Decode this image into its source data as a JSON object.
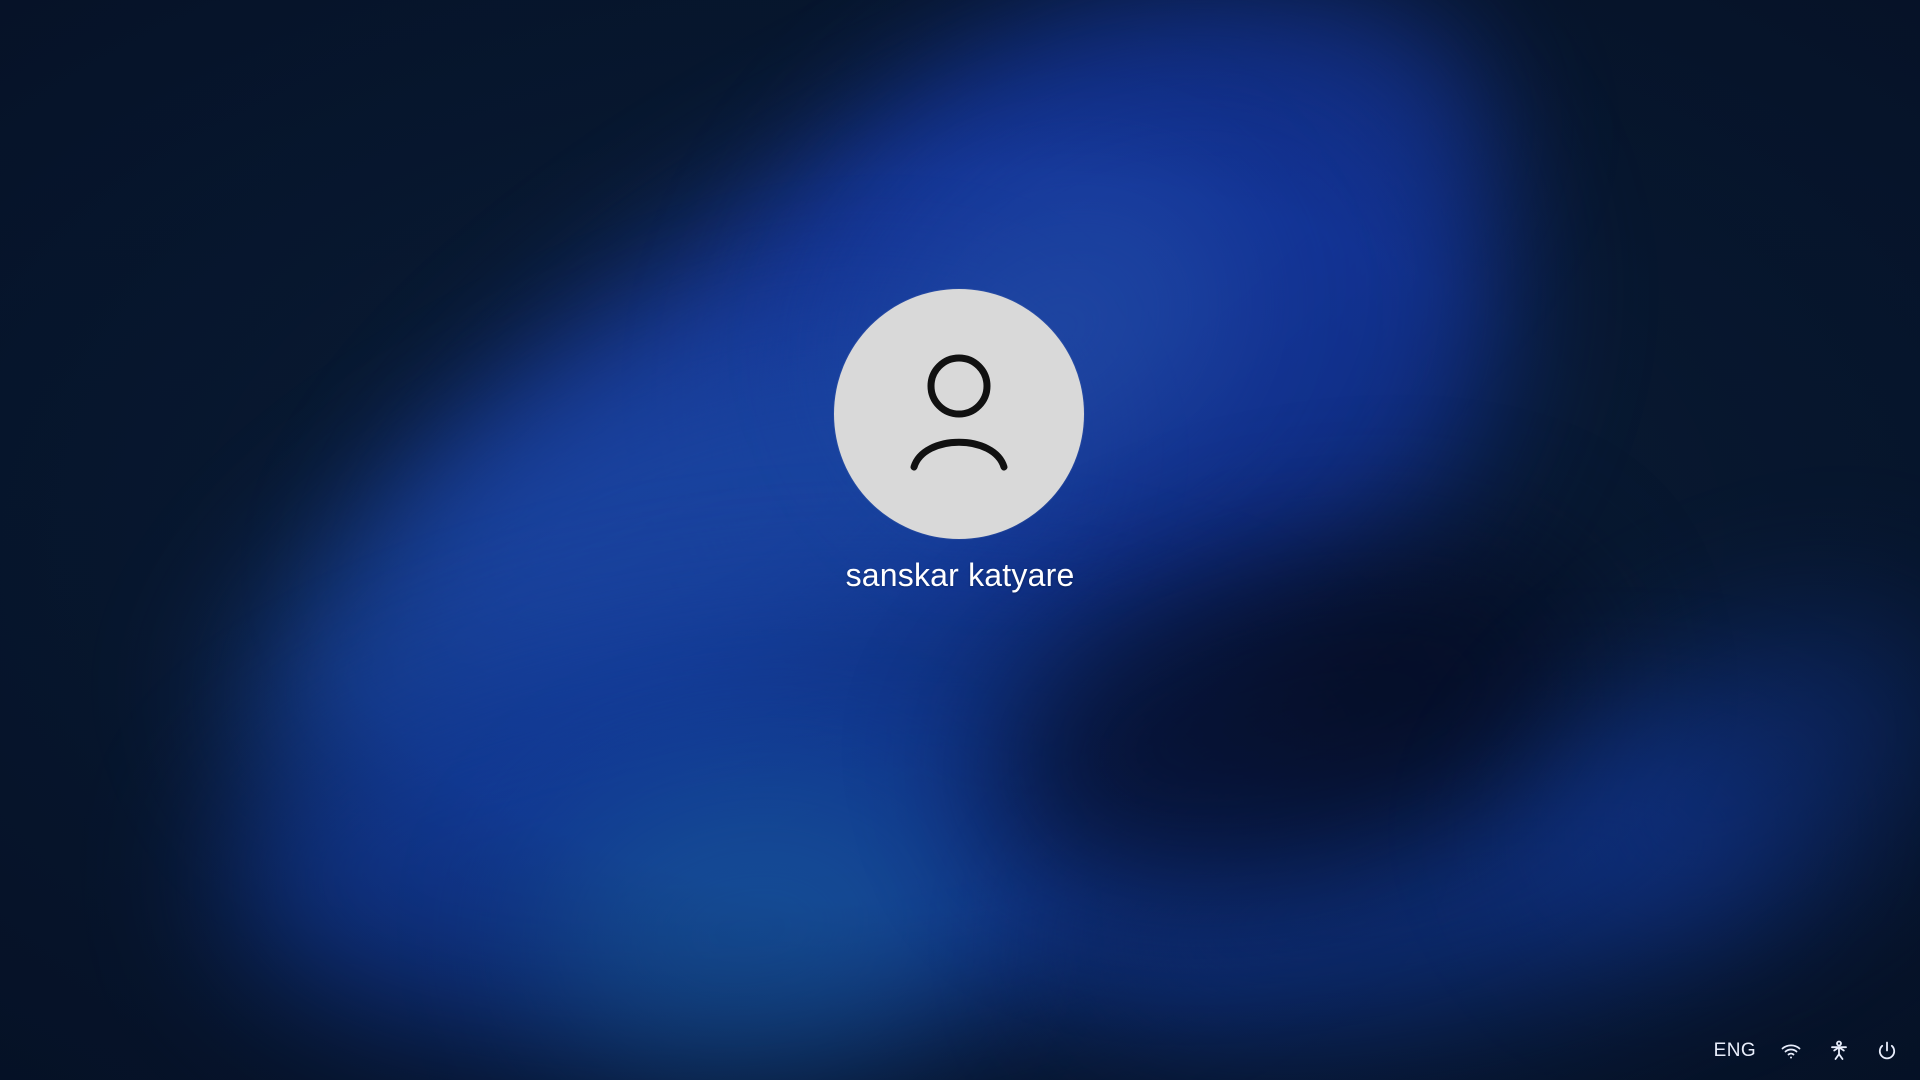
{
  "screen": {
    "type": "lock-screen",
    "user": {
      "name": "sanskar katyare",
      "avatar_icon": "user-icon"
    },
    "tray": {
      "language": "ENG",
      "icons": [
        "wifi-icon",
        "accessibility-icon",
        "power-icon"
      ]
    },
    "colors": {
      "background": "#081a33",
      "avatar_fill": "#d9d9d9",
      "text": "#ffffff",
      "accent": "#1438a4"
    }
  }
}
